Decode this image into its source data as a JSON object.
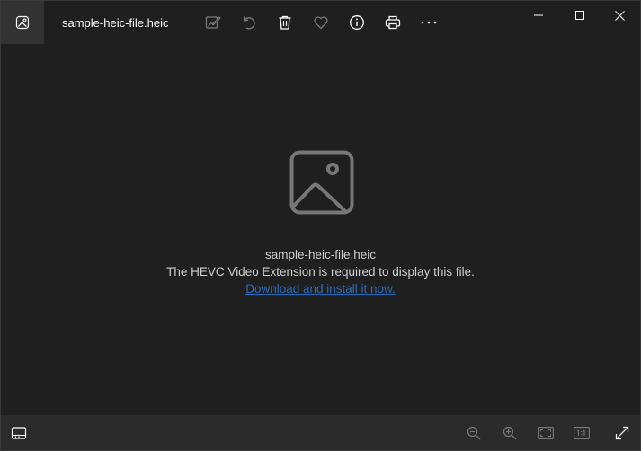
{
  "window": {
    "title": "sample-heic-file.heic"
  },
  "toolbar": {
    "items": [
      {
        "name": "edit-icon",
        "enabled": false
      },
      {
        "name": "rotate-icon",
        "enabled": false
      },
      {
        "name": "delete-icon",
        "enabled": true
      },
      {
        "name": "favorite-icon",
        "enabled": false
      },
      {
        "name": "info-icon",
        "enabled": true
      },
      {
        "name": "print-icon",
        "enabled": true
      },
      {
        "name": "more-icon",
        "enabled": true
      }
    ]
  },
  "message": {
    "filename": "sample-heic-file.heic",
    "required": "The HEVC Video Extension is required to display this file.",
    "link": "Download and install it now."
  },
  "bottombar": {
    "items": [
      "filmstrip-icon",
      "zoom-out-icon",
      "zoom-in-icon",
      "fit-to-window-icon",
      "actual-size-icon",
      "full-screen-icon"
    ]
  },
  "colors": {
    "background": "#1f1f1f",
    "bottombar": "#2b2b2b",
    "link": "#2a6cbc",
    "icon_enabled": "#ffffff",
    "icon_disabled": "#7a7a7a"
  }
}
